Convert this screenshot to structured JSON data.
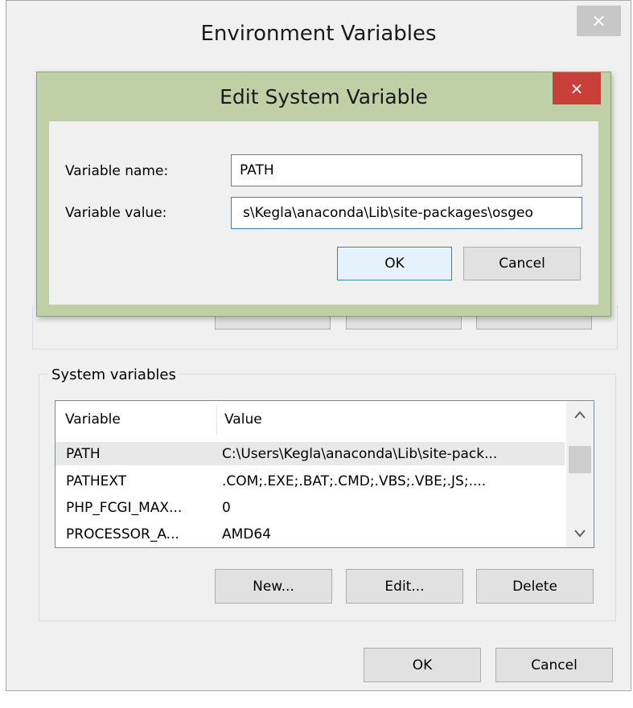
{
  "env_window": {
    "title": "Environment Variables",
    "close_glyph": "×"
  },
  "edit_dialog": {
    "title": "Edit System Variable",
    "close_glyph": "×",
    "name_label": "Variable name:",
    "name_value": "PATH",
    "value_label": "Variable value:",
    "value_value": "s\\Kegla\\anaconda\\Lib\\site-packages\\osgeo",
    "ok_label": "OK",
    "cancel_label": "Cancel",
    "accent_color": "#bfd0a6",
    "close_color": "#c9403a"
  },
  "system_vars": {
    "group_label": "System variables",
    "columns": [
      "Variable",
      "Value"
    ],
    "rows": [
      {
        "variable": "PATH",
        "value": "C:\\Users\\Kegla\\anaconda\\Lib\\site-pack..."
      },
      {
        "variable": "PATHEXT",
        "value": ".COM;.EXE;.BAT;.CMD;.VBS;.VBE;.JS;...."
      },
      {
        "variable": "PHP_FCGI_MAX...",
        "value": "0"
      },
      {
        "variable": "PROCESSOR_A...",
        "value": "AMD64"
      }
    ],
    "selected_row": 0,
    "new_label": "New...",
    "edit_label": "Edit...",
    "delete_label": "Delete",
    "scroll_up_icon": "chevron-up-icon",
    "scroll_down_icon": "chevron-down-icon"
  },
  "footer": {
    "ok_label": "OK",
    "cancel_label": "Cancel"
  }
}
